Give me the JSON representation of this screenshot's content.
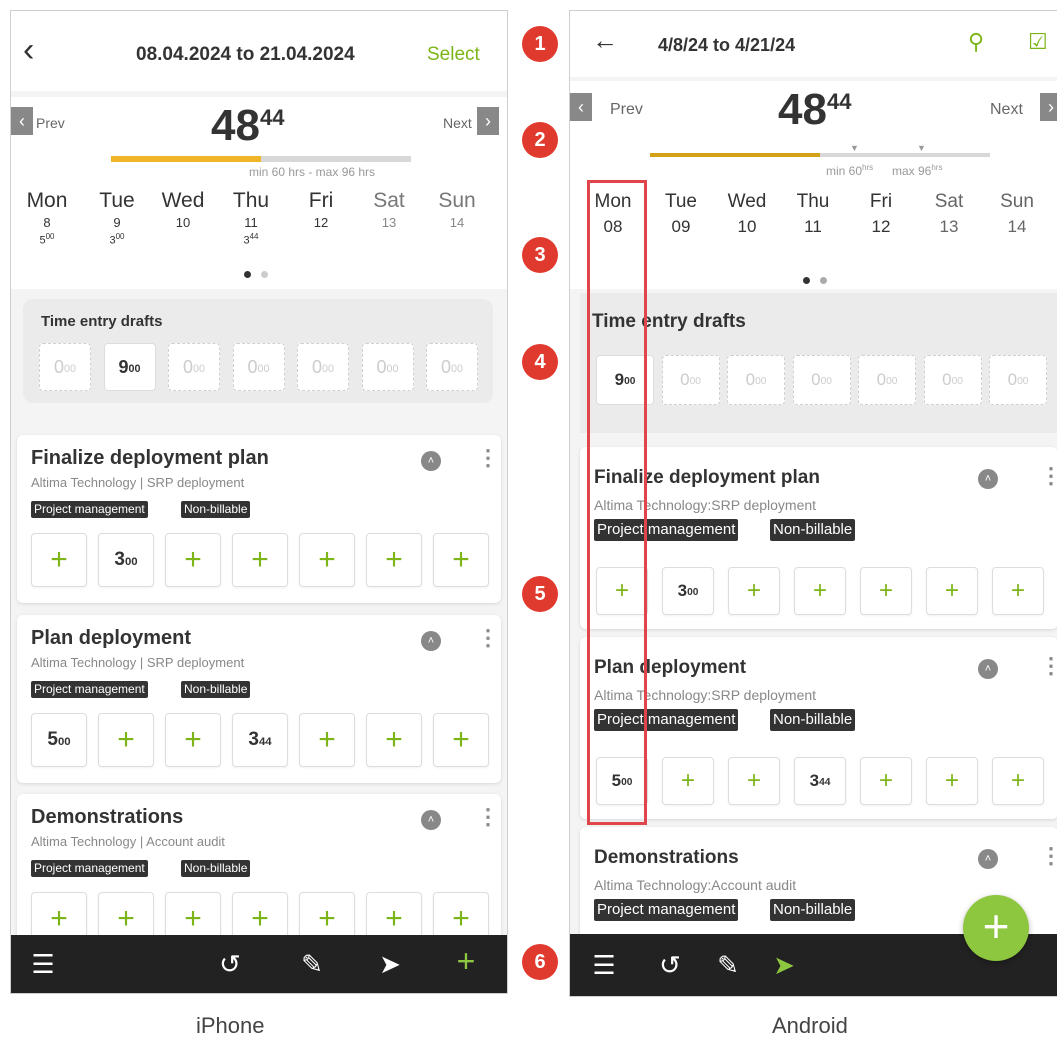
{
  "iphone": {
    "range": "08.04.2024 to 21.04.2024",
    "select_label": "Select",
    "prev": "Prev",
    "next": "Next",
    "total_main": "48",
    "total_sup": "44",
    "bar_note": "min 60 hrs - max 96 hrs",
    "progress_fraction": 0.5,
    "days": [
      {
        "name": "Mon",
        "date": "8",
        "hours": "5",
        "min": "00"
      },
      {
        "name": "Tue",
        "date": "9",
        "hours": "3",
        "min": "00"
      },
      {
        "name": "Wed",
        "date": "10",
        "hours": "",
        "min": ""
      },
      {
        "name": "Thu",
        "date": "11",
        "hours": "3",
        "min": "44"
      },
      {
        "name": "Fri",
        "date": "12",
        "hours": "",
        "min": ""
      },
      {
        "name": "Sat",
        "date": "13",
        "hours": "",
        "min": ""
      },
      {
        "name": "Sun",
        "date": "14",
        "hours": "",
        "min": ""
      }
    ],
    "drafts_label": "Time entry drafts",
    "drafts": [
      {
        "h": "0",
        "m": "00",
        "filled": false
      },
      {
        "h": "9",
        "m": "00",
        "filled": true
      },
      {
        "h": "0",
        "m": "00",
        "filled": false
      },
      {
        "h": "0",
        "m": "00",
        "filled": false
      },
      {
        "h": "0",
        "m": "00",
        "filled": false
      },
      {
        "h": "0",
        "m": "00",
        "filled": false
      },
      {
        "h": "0",
        "m": "00",
        "filled": false
      }
    ],
    "tasks": [
      {
        "name": "Finalize deployment plan",
        "sub": "Altima Technology | SRP deployment",
        "tags": [
          "Project management",
          "Non-billable"
        ],
        "cells": [
          "+",
          "3|00",
          "+",
          "+",
          "+",
          "+",
          "+"
        ]
      },
      {
        "name": "Plan deployment",
        "sub": "Altima Technology | SRP deployment",
        "tags": [
          "Project management",
          "Non-billable"
        ],
        "cells": [
          "5|00",
          "+",
          "+",
          "3|44",
          "+",
          "+",
          "+"
        ]
      },
      {
        "name": "Demonstrations",
        "sub": "Altima Technology | Account audit",
        "tags": [
          "Project management",
          "Non-billable"
        ],
        "cells": [
          "+",
          "+",
          "+",
          "+",
          "+",
          "+",
          "+"
        ]
      }
    ],
    "caption": "iPhone"
  },
  "android": {
    "range": "4/8/24 to 4/21/24",
    "prev": "Prev",
    "next": "Next",
    "total_main": "48",
    "total_sup": "44",
    "min_label": "min 60",
    "max_label": "max 96",
    "hrs": "hrs",
    "progress_fraction": 0.5,
    "days": [
      {
        "name": "Mon",
        "date": "08"
      },
      {
        "name": "Tue",
        "date": "09"
      },
      {
        "name": "Wed",
        "date": "10"
      },
      {
        "name": "Thu",
        "date": "11"
      },
      {
        "name": "Fri",
        "date": "12"
      },
      {
        "name": "Sat",
        "date": "13"
      },
      {
        "name": "Sun",
        "date": "14"
      }
    ],
    "drafts_label": "Time entry drafts",
    "drafts": [
      {
        "h": "9",
        "m": "00",
        "filled": true
      },
      {
        "h": "0",
        "m": "00",
        "filled": false
      },
      {
        "h": "0",
        "m": "00",
        "filled": false
      },
      {
        "h": "0",
        "m": "00",
        "filled": false
      },
      {
        "h": "0",
        "m": "00",
        "filled": false
      },
      {
        "h": "0",
        "m": "00",
        "filled": false
      },
      {
        "h": "0",
        "m": "00",
        "filled": false
      }
    ],
    "tasks": [
      {
        "name": "Finalize deployment plan",
        "sub": "Altima Technology:SRP deployment",
        "tags": [
          "Project management",
          "Non-billable"
        ],
        "cells": [
          "+",
          "3|00",
          "+",
          "+",
          "+",
          "+",
          "+"
        ]
      },
      {
        "name": "Plan deployment",
        "sub": "Altima Technology:SRP deployment",
        "tags": [
          "Project management",
          "Non-billable"
        ],
        "cells": [
          "5|00",
          "+",
          "+",
          "3|44",
          "+",
          "+",
          "+"
        ]
      },
      {
        "name": "Demonstrations",
        "sub": "Altima Technology:Account audit",
        "tags": [
          "Project management",
          "Non-billable"
        ],
        "cells": []
      }
    ],
    "caption": "Android"
  },
  "markers": [
    "1",
    "2",
    "3",
    "4",
    "5",
    "6"
  ],
  "colors": {
    "accent_green": "#7cb518",
    "progress_orange": "#f0b429",
    "marker_red": "#e03a2e",
    "dark_bar": "#222222"
  }
}
